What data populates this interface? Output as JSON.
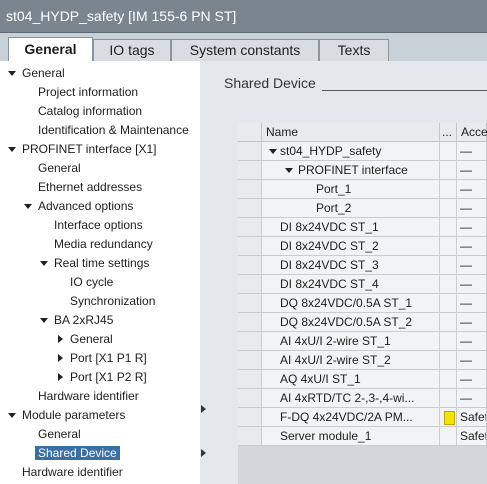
{
  "window": {
    "title": "st04_HYDP_safety [IM 155-6 PN ST]"
  },
  "tabs": [
    {
      "label": "General",
      "active": true
    },
    {
      "label": "IO tags",
      "active": false
    },
    {
      "label": "System constants",
      "active": false
    },
    {
      "label": "Texts",
      "active": false
    }
  ],
  "tree": {
    "items": [
      {
        "label": "General",
        "expander": "down"
      },
      {
        "label": "Project information"
      },
      {
        "label": "Catalog information"
      },
      {
        "label": "Identification & Maintenance"
      },
      {
        "label": "PROFINET interface [X1]",
        "expander": "down"
      },
      {
        "label": "General"
      },
      {
        "label": "Ethernet addresses"
      },
      {
        "label": "Advanced options",
        "expander": "down"
      },
      {
        "label": "Interface options"
      },
      {
        "label": "Media redundancy"
      },
      {
        "label": "Real time settings",
        "expander": "down"
      },
      {
        "label": "IO cycle"
      },
      {
        "label": "Synchronization"
      },
      {
        "label": "BA 2xRJ45",
        "expander": "down"
      },
      {
        "label": "General",
        "expander": "right"
      },
      {
        "label": "Port [X1 P1 R]",
        "expander": "right"
      },
      {
        "label": "Port [X1 P2 R]",
        "expander": "right"
      },
      {
        "label": "Hardware identifier"
      },
      {
        "label": "Module parameters",
        "expander": "down"
      },
      {
        "label": "General"
      },
      {
        "label": "Shared Device",
        "selected": true
      },
      {
        "label": "Hardware identifier"
      }
    ]
  },
  "content": {
    "section_title": "Shared Device",
    "table": {
      "columns": {
        "name": "Name",
        "indicator": "...",
        "access": "Access"
      },
      "rows": [
        {
          "name": "st04_HYDP_safety",
          "access": "—",
          "expander": "down"
        },
        {
          "name": "PROFINET interface",
          "access": "—",
          "expander": "down"
        },
        {
          "name": "Port_1",
          "access": "—"
        },
        {
          "name": "Port_2",
          "access": "—"
        },
        {
          "name": "DI 8x24VDC ST_1",
          "access": "—"
        },
        {
          "name": "DI 8x24VDC ST_2",
          "access": "—"
        },
        {
          "name": "DI 8x24VDC ST_3",
          "access": "—"
        },
        {
          "name": "DI 8x24VDC ST_4",
          "access": "—"
        },
        {
          "name": "DQ 8x24VDC/0.5A ST_1",
          "access": "—"
        },
        {
          "name": "DQ 8x24VDC/0.5A ST_2",
          "access": "—"
        },
        {
          "name": "AI 4xU/I 2-wire ST_1",
          "access": "—"
        },
        {
          "name": "AI 4xU/I 2-wire ST_2",
          "access": "—"
        },
        {
          "name": "AQ 4xU/I ST_1",
          "access": "—"
        },
        {
          "name": "AI 4xRTD/TC 2-,3-,4-wi...",
          "access": "—"
        },
        {
          "name": "F-DQ 4x24VDC/2A PM...",
          "access": "Safet...",
          "indicator": "yellow"
        },
        {
          "name": "Server module_1",
          "access": "Safet..."
        }
      ]
    }
  },
  "colors": {
    "titlebar": "#7a8590",
    "selection": "#3a6ea5",
    "indicator_yellow": "#f5e200"
  }
}
